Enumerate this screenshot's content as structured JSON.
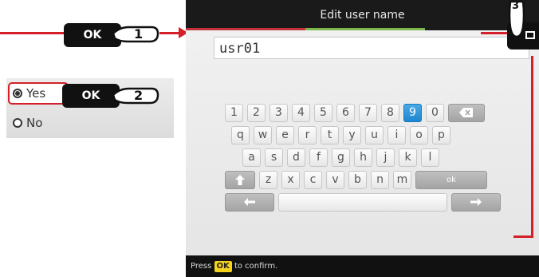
{
  "screen": {
    "title": "Edit user name",
    "input_value": "usr01",
    "footer": {
      "prefix": "Press",
      "ok": "OK",
      "suffix": "to confirm."
    }
  },
  "keyboard": {
    "row1": [
      "1",
      "2",
      "3",
      "4",
      "5",
      "6",
      "7",
      "8",
      "9",
      "0"
    ],
    "row2": [
      "q",
      "w",
      "e",
      "r",
      "t",
      "y",
      "u",
      "i",
      "o",
      "p"
    ],
    "row3": [
      "a",
      "s",
      "d",
      "f",
      "g",
      "h",
      "j",
      "k",
      "l"
    ],
    "row4": [
      "z",
      "x",
      "c",
      "v",
      "b",
      "n",
      "m"
    ],
    "selected_key": "9",
    "ok_key": "ok",
    "backspace_icon": "backspace-icon",
    "shift_icon": "shift-icon",
    "left_icon": "arrow-left-icon",
    "right_icon": "arrow-right-icon"
  },
  "callouts": {
    "ok_label": "OK",
    "step1": "1",
    "step2": "2",
    "step3": "3"
  },
  "radio": {
    "yes": "Yes",
    "no": "No"
  },
  "colors": {
    "accent_red": "#d4202a",
    "selected_blue": "#2a93d9",
    "ok_yellow": "#f5d31a"
  }
}
